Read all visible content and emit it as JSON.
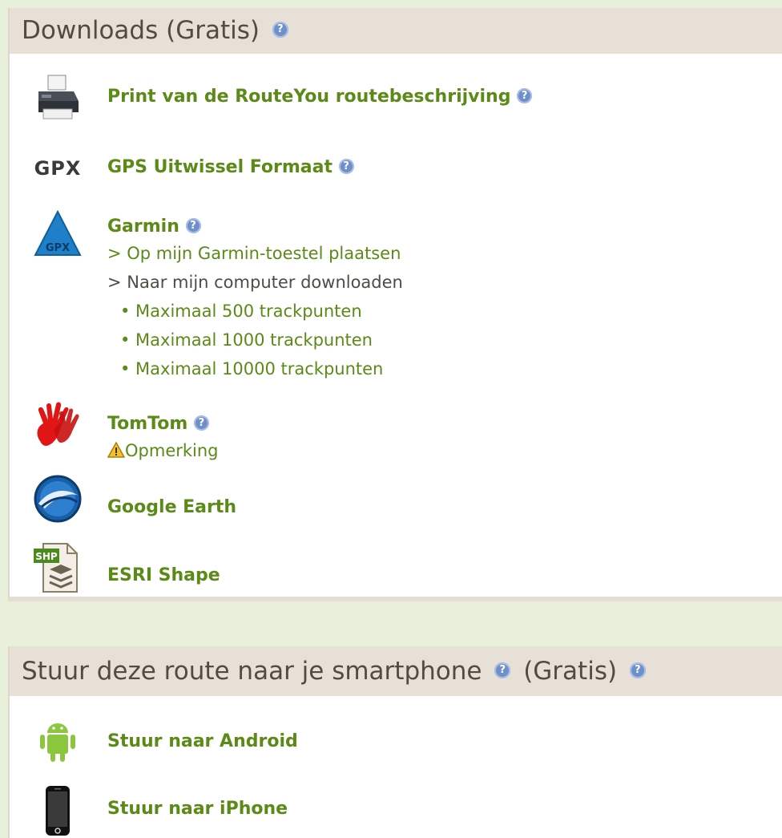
{
  "downloads": {
    "title": "Downloads (Gratis)",
    "items": {
      "print": "Print van de RouteYou routebeschrijving",
      "gpx_icon_text": "GPX",
      "gpx": "GPS Uitwissel Formaat",
      "garmin": "Garmin",
      "garmin_icon_text": "GPX",
      "garmin_place": "> Op mijn Garmin-toestel plaatsen",
      "garmin_download": "> Naar mijn computer downloaden",
      "garmin_options": [
        "• Maximaal 500 trackpunten",
        "• Maximaal 1000 trackpunten",
        "• Maximaal 10000 trackpunten"
      ],
      "tomtom": "TomTom",
      "tomtom_note": "Opmerking",
      "google_earth": "Google Earth",
      "esri": "ESRI Shape",
      "esri_icon_text": "SHP"
    }
  },
  "smartphone": {
    "title_part1": "Stuur deze route naar je smartphone",
    "title_part2": "(Gratis)",
    "android": "Stuur naar Android",
    "iphone": "Stuur naar iPhone"
  },
  "colors": {
    "link": "#5b8a17",
    "header_bg": "#e6e0d6",
    "page_bg": "#e8f0dc",
    "help_icon": "#6f8fc9"
  }
}
